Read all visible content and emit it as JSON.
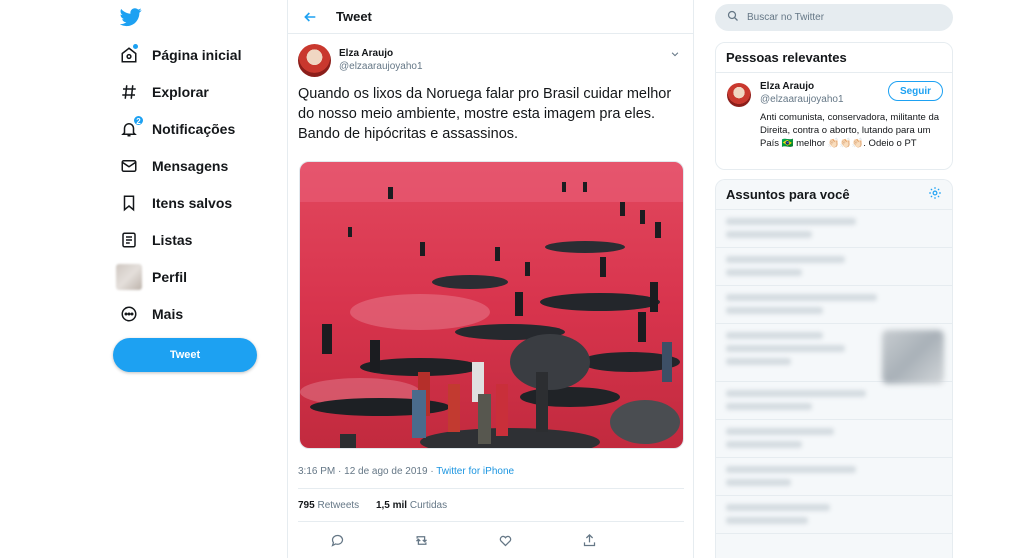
{
  "nav": {
    "items": [
      {
        "label": "Página inicial",
        "icon": "home-icon"
      },
      {
        "label": "Explorar",
        "icon": "hashtag-icon"
      },
      {
        "label": "Notificações",
        "icon": "bell-icon",
        "badge": "2"
      },
      {
        "label": "Mensagens",
        "icon": "envelope-icon"
      },
      {
        "label": "Itens salvos",
        "icon": "bookmark-icon"
      },
      {
        "label": "Listas",
        "icon": "list-icon"
      },
      {
        "label": "Perfil",
        "icon": "avatar"
      },
      {
        "label": "Mais",
        "icon": "more-icon"
      }
    ],
    "tweet_button": "Tweet"
  },
  "main": {
    "title": "Tweet",
    "author": {
      "name": "Elza Araujo",
      "handle": "@elzaaraujoyaho1"
    },
    "text": "Quando os lixos da Noruega falar pro Brasil cuidar melhor do nosso meio ambiente, mostre esta imagem pra eles. Bando de hipócritas e assassinos.",
    "time": "3:16 PM · 12 de ago de 2019 · ",
    "source": "Twitter for iPhone",
    "retweets_count": "795",
    "retweets_label": "Retweets",
    "likes_count": "1,5 mil",
    "likes_label": "Curtidas"
  },
  "right": {
    "search_placeholder": "Buscar no Twitter",
    "relevant": {
      "title": "Pessoas relevantes",
      "name": "Elza Araujo",
      "handle": "@elzaaraujoyaho1",
      "follow": "Seguir",
      "bio": "Anti comunista, conservadora, militante da Direita, contra o aborto, lutando para um País 🇧🇷 melhor 👏🏻👏🏻👏🏻. Odeio o PT"
    },
    "trends": {
      "title": "Assuntos para você"
    }
  },
  "colors": {
    "accent": "#1da1f2",
    "text": "#14171a",
    "muted": "#657786",
    "border": "#e6ecf0"
  }
}
